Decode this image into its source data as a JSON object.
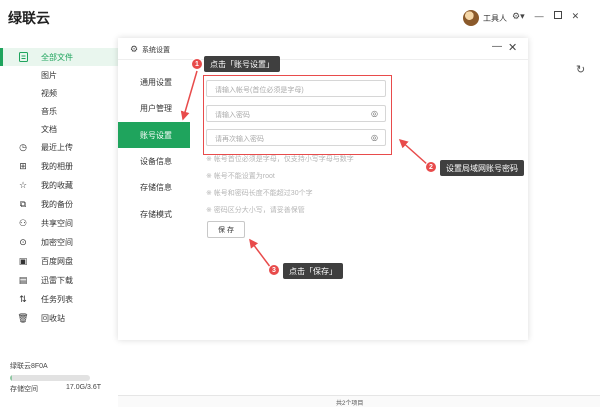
{
  "app": {
    "title": "绿联云",
    "user_name": "工具人"
  },
  "sidebar": {
    "items": [
      {
        "label": "全部文件",
        "icon": "file-icon",
        "active": true
      },
      {
        "label": "图片",
        "icon": "",
        "sub": true
      },
      {
        "label": "视频",
        "icon": "",
        "sub": true
      },
      {
        "label": "音乐",
        "icon": "",
        "sub": true
      },
      {
        "label": "文档",
        "icon": "",
        "sub": true
      },
      {
        "label": "最近上传",
        "icon": "clock-icon"
      },
      {
        "label": "我的相册",
        "icon": "album-icon"
      },
      {
        "label": "我的收藏",
        "icon": "star-icon"
      },
      {
        "label": "我的备份",
        "icon": "backup-icon"
      },
      {
        "label": "共享空间",
        "icon": "users-icon"
      },
      {
        "label": "加密空间",
        "icon": "lock-icon"
      },
      {
        "label": "百度网盘",
        "icon": "cloud-icon"
      },
      {
        "label": "迅雷下载",
        "icon": "thunder-icon"
      },
      {
        "label": "任务列表",
        "icon": "sort-icon"
      },
      {
        "label": "回收站",
        "icon": "trash-icon"
      }
    ],
    "storage": {
      "device": "绿联云8F0A",
      "label": "存储空间",
      "value": "17.0G/3.6T",
      "used_fraction": 0.005
    }
  },
  "dialog": {
    "title": "系统设置",
    "tabs": [
      {
        "label": "通用设置"
      },
      {
        "label": "用户管理"
      },
      {
        "label": "账号设置",
        "active": true
      },
      {
        "label": "设备信息"
      },
      {
        "label": "存储信息"
      },
      {
        "label": "存储模式"
      }
    ],
    "fields": [
      {
        "placeholder": "请输入帐号(首位必须是字母)",
        "eye": false
      },
      {
        "placeholder": "请输入密码",
        "eye": true
      },
      {
        "placeholder": "请再次输入密码",
        "eye": true
      }
    ],
    "hints": [
      "※ 帐号首位必须是字母，仅支持小写字母与数字",
      "※ 帐号不能设置为root",
      "※ 帐号和密码长度不能超过30个字",
      "※ 密码区分大小写，请妥善保管"
    ],
    "save_label": "保 存"
  },
  "status": {
    "text": "共2个项目"
  },
  "annotations": [
    {
      "num": "1",
      "text": "点击「账号设置」"
    },
    {
      "num": "2",
      "text": "设置局域网账号密码"
    },
    {
      "num": "3",
      "text": "点击「保存」"
    }
  ],
  "colors": {
    "accent": "#1fa45d",
    "annotation_red": "#e84b4b"
  }
}
